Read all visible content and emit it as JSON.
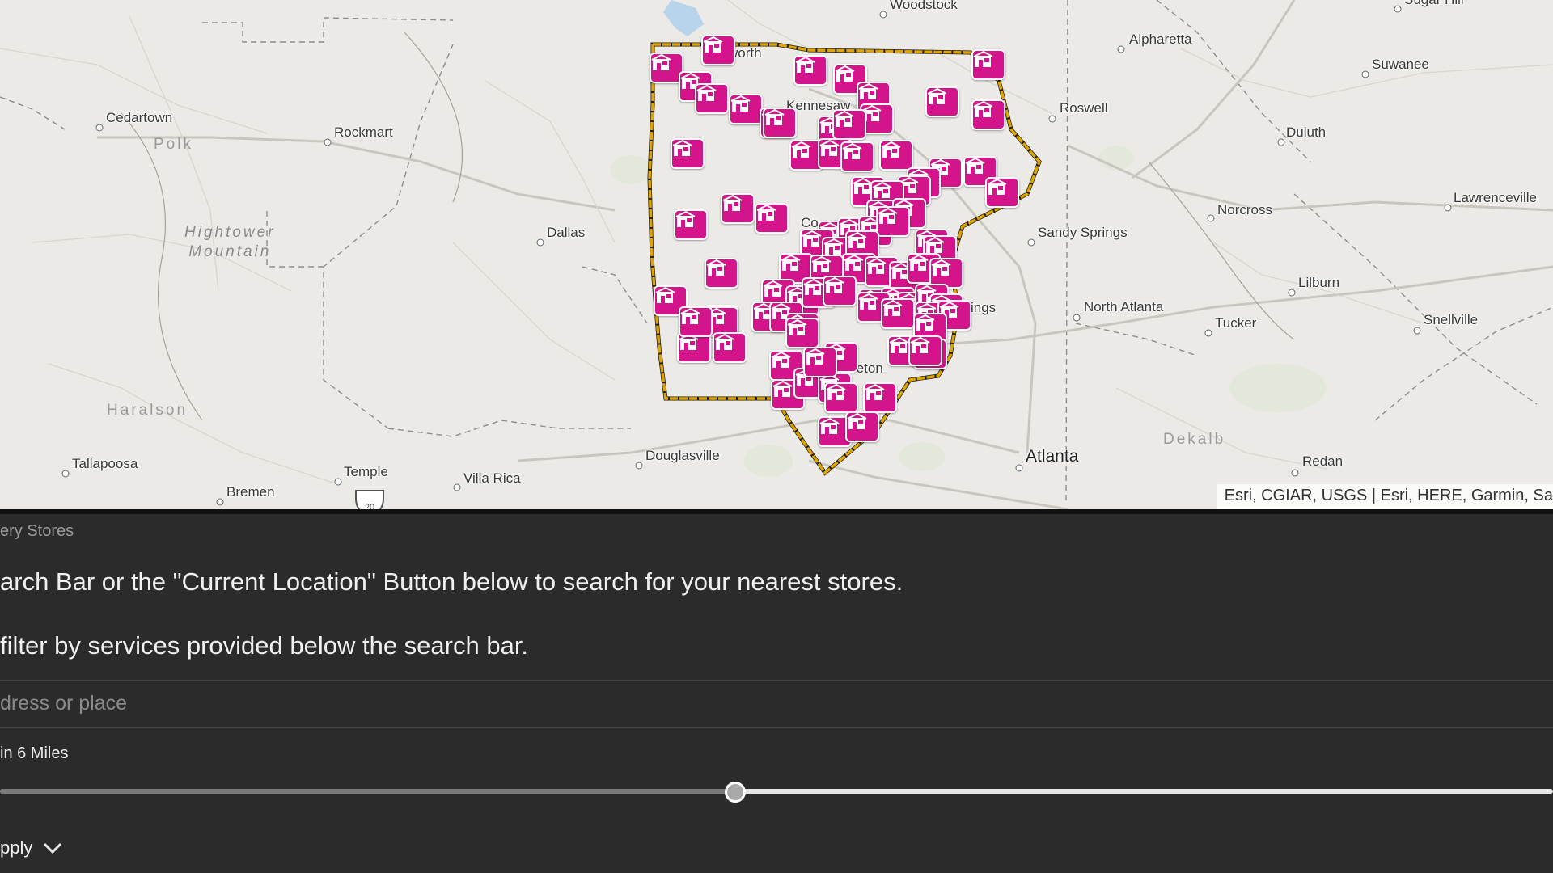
{
  "map": {
    "attribution": "Esri, CGIAR, USGS | Esri, HERE, Garmin, Sa",
    "colors": {
      "background": "#eceae6",
      "boundary": "#e0a400",
      "marker": "#d4148a"
    },
    "marker_icon": "store-icon",
    "cities": [
      {
        "id": "woodstock",
        "name": "Woodstock"
      },
      {
        "id": "alpharetta",
        "name": "Alpharetta"
      },
      {
        "id": "sugar-hill",
        "name": "Sugar Hill"
      },
      {
        "id": "suwanee",
        "name": "Suwanee"
      },
      {
        "id": "roswell",
        "name": "Roswell"
      },
      {
        "id": "duluth",
        "name": "Duluth"
      },
      {
        "id": "cedartown",
        "name": "Cedartown"
      },
      {
        "id": "rockmart",
        "name": "Rockmart"
      },
      {
        "id": "lawrenceville",
        "name": "Lawrenceville"
      },
      {
        "id": "norcross",
        "name": "Norcross"
      },
      {
        "id": "sandy-springs",
        "name": "Sandy Springs"
      },
      {
        "id": "dallas",
        "name": "Dallas"
      },
      {
        "id": "lilburn",
        "name": "Lilburn"
      },
      {
        "id": "north-atlanta",
        "name": "North Atlanta"
      },
      {
        "id": "tucker",
        "name": "Tucker"
      },
      {
        "id": "snellville",
        "name": "Snellville"
      },
      {
        "id": "douglasville",
        "name": "Douglasville"
      },
      {
        "id": "atlanta",
        "name": "Atlanta"
      },
      {
        "id": "redan",
        "name": "Redan"
      },
      {
        "id": "tallapoosa",
        "name": "Tallapoosa"
      },
      {
        "id": "temple",
        "name": "Temple"
      },
      {
        "id": "villa-rica",
        "name": "Villa Rica"
      },
      {
        "id": "bremen",
        "name": "Bremen"
      }
    ],
    "partial_labels": [
      {
        "id": "acworth",
        "text": "worth"
      },
      {
        "id": "kennesaw",
        "text": "Kennesaw"
      },
      {
        "id": "marietta",
        "text": "Co"
      },
      {
        "id": "smyrna",
        "text": "ings"
      },
      {
        "id": "mableton",
        "text": "ableton"
      }
    ],
    "regions": [
      {
        "id": "hightower",
        "text": "Hightower\nMountain"
      },
      {
        "id": "polk",
        "text": "Polk"
      },
      {
        "id": "haralson",
        "text": "Haralson"
      },
      {
        "id": "dekalb",
        "text": "Dekalb"
      }
    ]
  },
  "panel": {
    "title": "ery Stores",
    "instruction_1": "arch Bar or the \"Current Location\" Button below to search for your nearest stores.",
    "instruction_2": " filter by services provided below the search bar.",
    "search": {
      "placeholder": "dress or place",
      "value": ""
    },
    "radius_label": "in 6 Miles",
    "radius_slider": {
      "value_fraction": 0.473
    },
    "filter_toggle": {
      "label": "pply",
      "icon": "chevron-down-icon"
    }
  }
}
